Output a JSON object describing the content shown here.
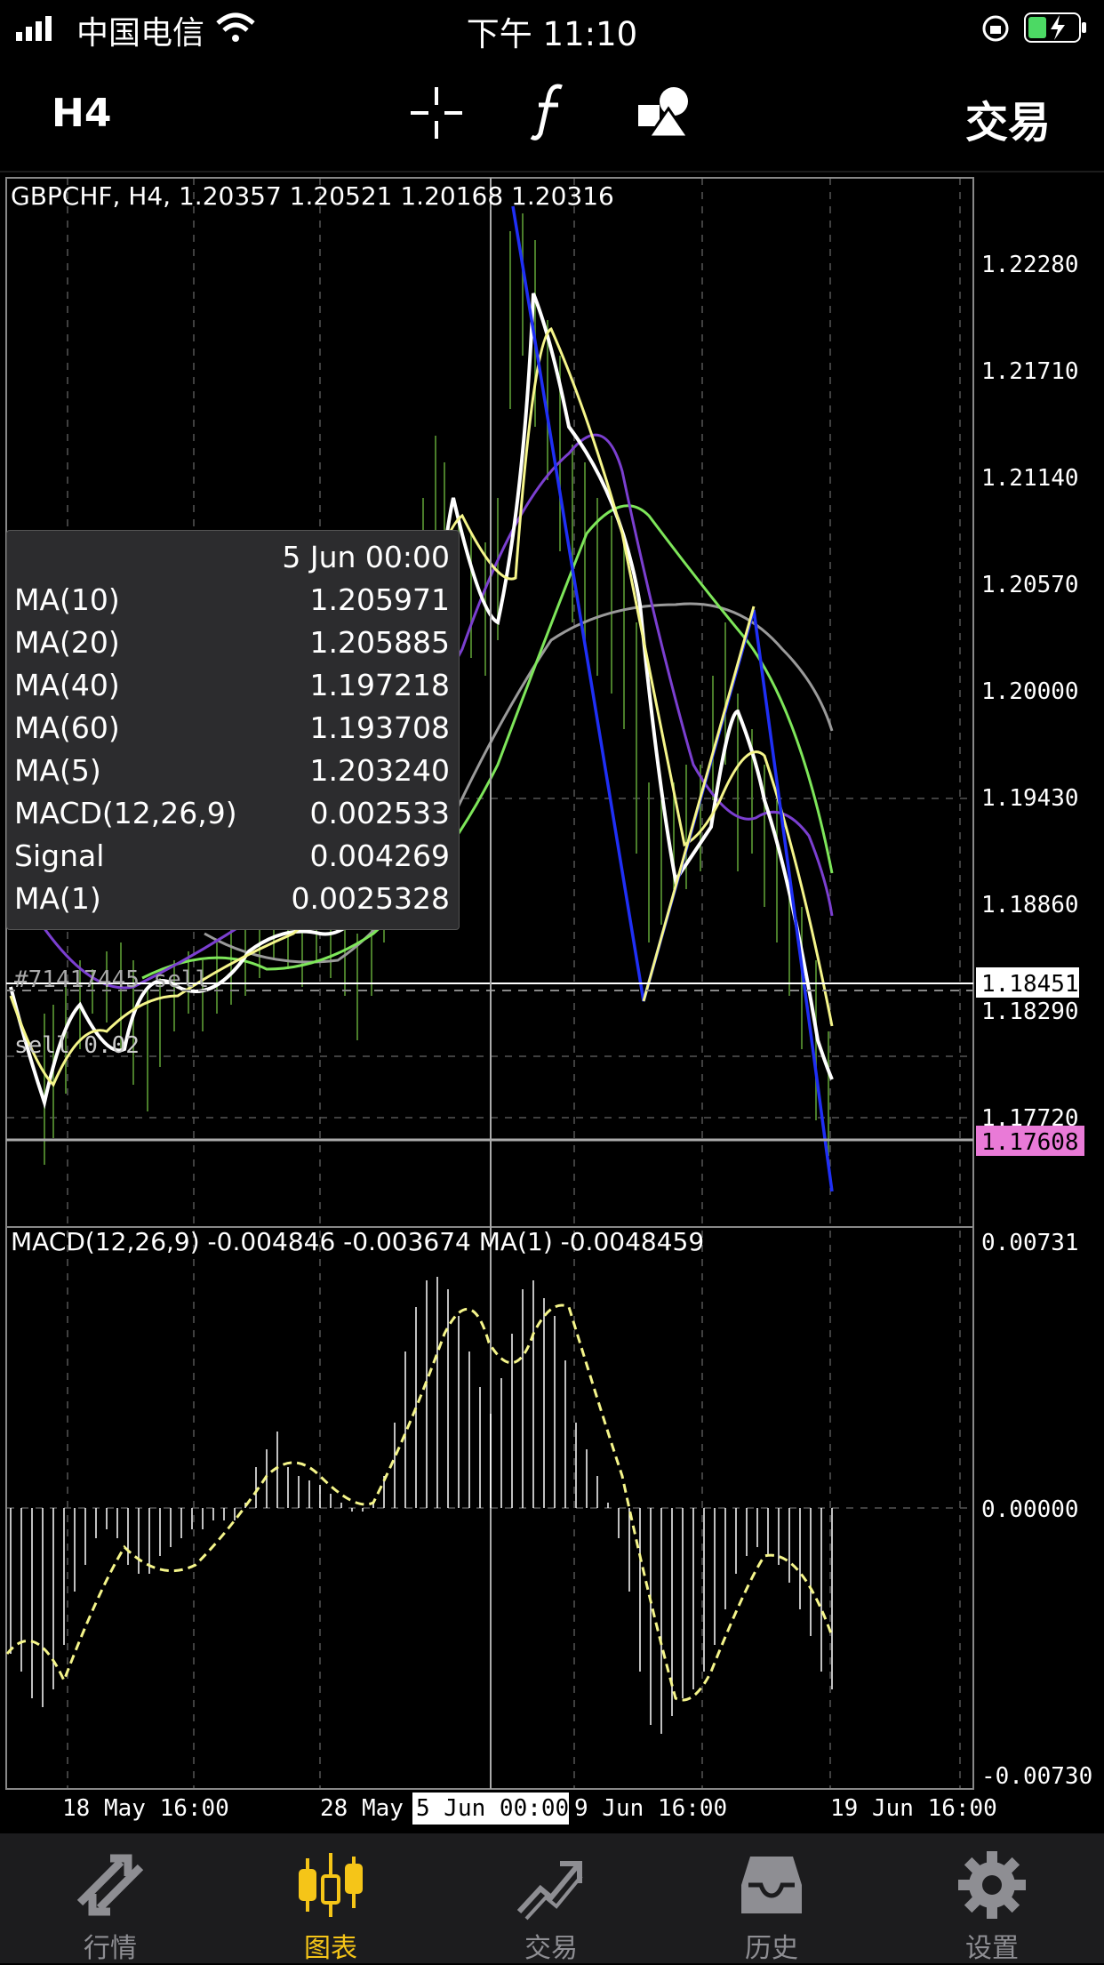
{
  "status": {
    "carrier": "中国电信",
    "time": "下午 11:10"
  },
  "toolbar": {
    "timeframe": "H4",
    "trade": "交易"
  },
  "chart": {
    "header": "GBPCHF, H4, 1.20357 1.20521 1.20168 1.20316",
    "price_ticks": [
      "1.22280",
      "1.21710",
      "1.21140",
      "1.20570",
      "1.20000",
      "1.19430",
      "1.18860",
      "1.18290",
      "1.17720"
    ],
    "price_tag_current": "1.18451",
    "price_tag_bid": "1.17608",
    "order_label": "#71417445 sell",
    "order_label2": "sell 0.02",
    "macd_header": "MACD(12,26,9) -0.004846 -0.003674 MA(1) -0.0048459",
    "macd_ticks": [
      "0.00731",
      "0.00000",
      "-0.00730"
    ],
    "time_ticks": [
      "18 May 16:00",
      "28 May",
      "9 Jun 16:00",
      "19 Jun 16:00"
    ],
    "crosshair_time": "5 Jun 00:00",
    "colors": {
      "bid_tag": "#e97ad7",
      "ma10": "#ffffff",
      "ma20": "#7b3fd0",
      "ma40": "#7ee65a",
      "ma60": "#9a9a9a",
      "ma5": "#f5f58a",
      "zigzag": "#1f2ff5"
    }
  },
  "tooltip": {
    "date": "5 Jun 00:00",
    "rows": [
      {
        "k": "MA(10)",
        "v": "1.205971"
      },
      {
        "k": "MA(20)",
        "v": "1.205885"
      },
      {
        "k": "MA(40)",
        "v": "1.197218"
      },
      {
        "k": "MA(60)",
        "v": "1.193708"
      },
      {
        "k": "MA(5)",
        "v": "1.203240"
      },
      {
        "k": "MACD(12,26,9)",
        "v": "0.002533"
      },
      {
        "k": "Signal",
        "v": "0.004269"
      },
      {
        "k": "MA(1)",
        "v": "0.0025328"
      }
    ]
  },
  "tabs": [
    {
      "label": "行情",
      "icon": "quotes-icon"
    },
    {
      "label": "图表",
      "icon": "chart-icon"
    },
    {
      "label": "交易",
      "icon": "trade-icon"
    },
    {
      "label": "历史",
      "icon": "history-icon"
    },
    {
      "label": "设置",
      "icon": "settings-icon"
    }
  ]
}
